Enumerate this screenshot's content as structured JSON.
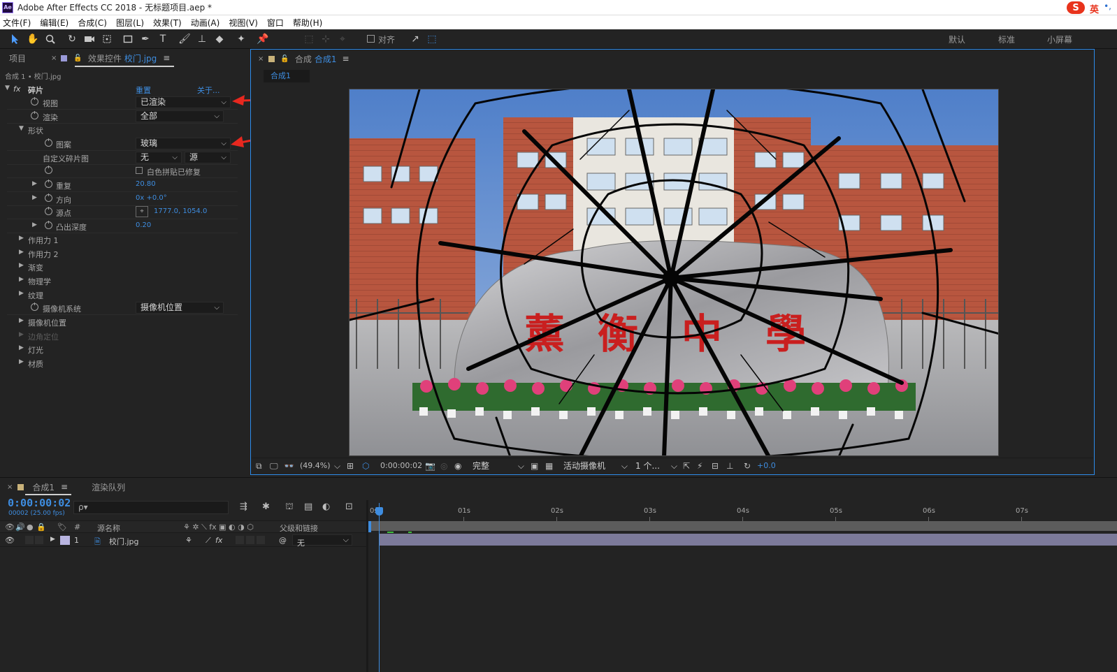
{
  "window": {
    "title": "Adobe After Effects CC 2018 - 无标题项目.aep *",
    "logo_text": "Ae",
    "ime": {
      "logo": "S",
      "lang": "英",
      "extra": "•,"
    }
  },
  "menu": [
    "文件(F)",
    "编辑(E)",
    "合成(C)",
    "图层(L)",
    "效果(T)",
    "动画(A)",
    "视图(V)",
    "窗口",
    "帮助(H)"
  ],
  "toolbar": {
    "snap_label": "对齐",
    "workspaces": [
      "默认",
      "标准",
      "小屏幕"
    ]
  },
  "left_panel": {
    "tabs": {
      "project": "项目",
      "effects_prefix": "效果控件",
      "effects_target": "校门.jpg"
    },
    "breadcrumb": "合成 1 • 校门.jpg",
    "effect": {
      "name": "碎片",
      "reset": "重置",
      "about": "关于..."
    },
    "props": {
      "view": {
        "label": "视图",
        "value": "已渲染"
      },
      "render": {
        "label": "渲染",
        "value": "全部"
      },
      "shape": {
        "label": "形状"
      },
      "pattern": {
        "label": "图案",
        "value": "玻璃"
      },
      "custom_map": {
        "label": "自定义碎片图",
        "value": "无",
        "value2": "源"
      },
      "white_tile": {
        "label": "白色拼贴已修复"
      },
      "repeat": {
        "label": "重复",
        "value": "20.80"
      },
      "direction": {
        "label": "方向",
        "value": "0x +0.0°"
      },
      "origin": {
        "label": "源点",
        "value": "1777.0, 1054.0"
      },
      "extrusion": {
        "label": "凸出深度",
        "value": "0.20"
      },
      "force1": {
        "label": "作用力 1"
      },
      "force2": {
        "label": "作用力 2"
      },
      "gradient": {
        "label": "渐变"
      },
      "physics": {
        "label": "物理学"
      },
      "texture": {
        "label": "纹理"
      },
      "camera_system": {
        "label": "摄像机系统",
        "value": "摄像机位置"
      },
      "camera_position": {
        "label": "摄像机位置"
      },
      "corner_pin": {
        "label": "边角定位"
      },
      "lighting": {
        "label": "灯光"
      },
      "material": {
        "label": "材质"
      }
    }
  },
  "comp_panel": {
    "tab_prefix": "合成",
    "tab_name": "合成1",
    "subtab": "合成1",
    "bar": {
      "zoom": "(49.4%)",
      "timecode": "0:00:00:02",
      "resolution": "完整",
      "camera": "活动摄像机",
      "views": "1 个...",
      "exposure": "+0.0"
    }
  },
  "timeline": {
    "tabs": {
      "comp": "合成1",
      "render_queue": "渲染队列"
    },
    "timecode": "0:00:00:02",
    "fps": "00002 (25.00 fps)",
    "search_placeholder": "ρ▾",
    "columns": {
      "num": "#",
      "source_name": "源名称",
      "parent": "父级和链接"
    },
    "layer": {
      "index": "1",
      "name": "校门.jpg",
      "parent": "无"
    },
    "ruler": [
      "0s",
      "01s",
      "02s",
      "03s",
      "04s",
      "05s",
      "06s",
      "07s"
    ]
  },
  "colors": {
    "accent_blue": "#3e8de0",
    "panel_bg": "#232323",
    "annotation_red": "#e8281f",
    "layer_bar": "#7c7a9a"
  }
}
